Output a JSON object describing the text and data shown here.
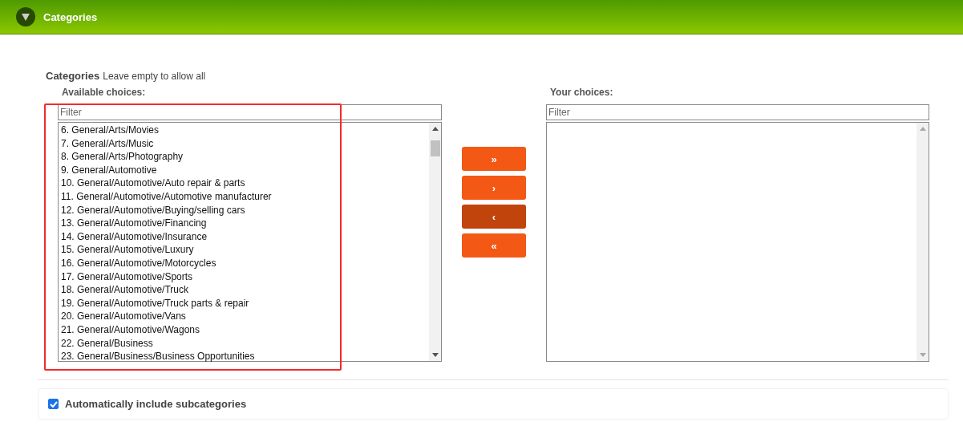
{
  "header": {
    "title": "Categories",
    "expanded": true
  },
  "field": {
    "label": "Categories",
    "hint": "Leave empty to allow all"
  },
  "available": {
    "label": "Available choices:",
    "filter": {
      "placeholder": "Filter"
    },
    "items": [
      {
        "text": "6. General/Arts/Movies"
      },
      {
        "text": "7. General/Arts/Music"
      },
      {
        "text": "8. General/Arts/Photography"
      },
      {
        "text": "9. General/Automotive"
      },
      {
        "text": "10. General/Automotive/Auto repair & parts"
      },
      {
        "text": "11. General/Automotive/Automotive manufacturer"
      },
      {
        "text": "12. General/Automotive/Buying/selling cars"
      },
      {
        "text": "13. General/Automotive/Financing"
      },
      {
        "text": "14. General/Automotive/Insurance"
      },
      {
        "text": "15. General/Automotive/Luxury"
      },
      {
        "text": "16. General/Automotive/Motorcycles"
      },
      {
        "text": "17. General/Automotive/Sports"
      },
      {
        "text": "18. General/Automotive/Truck"
      },
      {
        "text": "19. General/Automotive/Truck parts & repair"
      },
      {
        "text": "20. General/Automotive/Vans"
      },
      {
        "text": "21. General/Automotive/Wagons"
      },
      {
        "text": "22. General/Business"
      },
      {
        "text": "23. General/Business/Business Opportunities"
      }
    ]
  },
  "buttons": [
    {
      "label": "»",
      "active": false
    },
    {
      "label": "›",
      "active": false
    },
    {
      "label": "‹",
      "active": true
    },
    {
      "label": "«",
      "active": false
    }
  ],
  "chosen": {
    "label": "Your choices:",
    "filter": {
      "placeholder": "Filter"
    }
  },
  "subcategories": {
    "label": "Automatically include subcategories",
    "checked": true
  },
  "annotation": {
    "kind": "highlight-rectangle"
  }
}
